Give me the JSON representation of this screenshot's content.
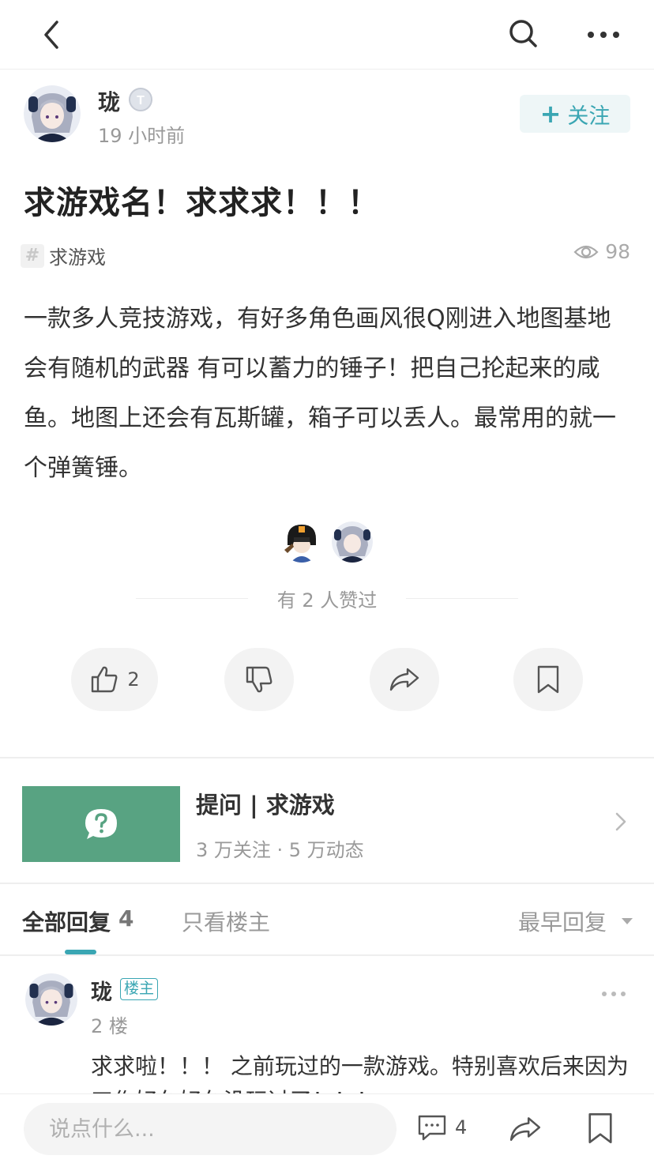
{
  "header": {
    "back_icon": "chevron-left-icon",
    "search_icon": "search-icon",
    "more_icon": "more-horizontal-icon"
  },
  "author": {
    "name": "珑",
    "level_badge": "T",
    "time": "19 小时前",
    "follow_label": "关注",
    "follow_plus": "+"
  },
  "post": {
    "title": "求游戏名！求求求！！！",
    "tag": "求游戏",
    "tag_icon": "#",
    "views": "98",
    "body": "一款多人竞技游戏，有好多角色画风很Q刚进入地图基地会有随机的武器 有可以蓄力的锤子！把自己抡起来的咸鱼。地图上还会有瓦斯罐，箱子可以丢人。最常用的就一个弹簧锤。"
  },
  "likes": {
    "summary": "有 2 人赞过"
  },
  "actions": {
    "like_count": "2"
  },
  "topic": {
    "title": "提问 | 求游戏",
    "stats": "3 万关注 · 5 万动态"
  },
  "replies_tabs": {
    "all_label": "全部回复",
    "all_count": "4",
    "op_only_label": "只看楼主",
    "sort_label": "最早回复"
  },
  "reply": {
    "name": "珑",
    "badge": "楼主",
    "floor": "2 楼",
    "text": "求求啦！！！ 之前玩过的一款游戏。特别喜欢后来因为工作好久好久没玩过了！！！"
  },
  "bottom_bar": {
    "input_placeholder": "说点什么...",
    "comment_count": "4"
  },
  "colors": {
    "accent": "#3aa6b3",
    "topic_card": "#58a382",
    "follow_bg": "#eef6f7"
  }
}
